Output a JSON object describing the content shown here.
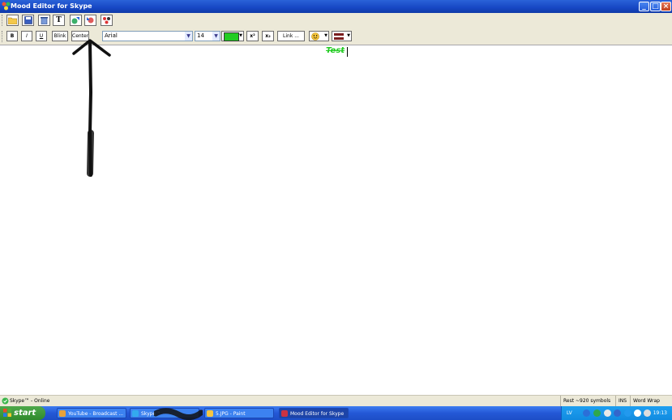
{
  "window": {
    "title": "Mood Editor for Skype",
    "controls": {
      "minimize": "_",
      "maximize": "□",
      "close": "×"
    }
  },
  "toolbar_main": {
    "buttons": [
      {
        "name": "open-folder",
        "icon": "folder-icon"
      },
      {
        "name": "save",
        "icon": "floppy-icon"
      },
      {
        "name": "clear",
        "icon": "trash-icon"
      },
      {
        "name": "text",
        "icon": "text-icon",
        "label": "T"
      },
      {
        "name": "export",
        "icon": "export-icon"
      },
      {
        "name": "import",
        "icon": "import-icon"
      },
      {
        "name": "tools",
        "icon": "tools-icon"
      }
    ]
  },
  "toolbar_format": {
    "bold": "B",
    "italic": "I",
    "underline": "U",
    "blink": "Blink",
    "center": "Center",
    "font_name": "Arial",
    "font_size": "14",
    "color": "#22cc22",
    "superscript": "x²",
    "subscript": "x₂",
    "link": "Link ...",
    "smiley_icon": "smiley-icon",
    "flag_icon": "flag-icon"
  },
  "editor": {
    "text": "Test"
  },
  "statusbar": {
    "status": "Skype™ - Online",
    "rest": "Rest ~920 symbols",
    "ins": "INS",
    "wrap": "Word Wrap"
  },
  "taskbar": {
    "start": "start",
    "tasks": [
      {
        "label": "YouTube - Broadcast ...",
        "color": "#e8a23a"
      },
      {
        "label": "Skype™",
        "color": "#33aaee"
      },
      {
        "label": "5.JPG - Paint",
        "color": "#f5c542"
      },
      {
        "label": "Mood Editor for Skype",
        "color": "#cc3344",
        "active": true
      }
    ],
    "tray": {
      "lang": "LV",
      "time": "19:13"
    }
  }
}
